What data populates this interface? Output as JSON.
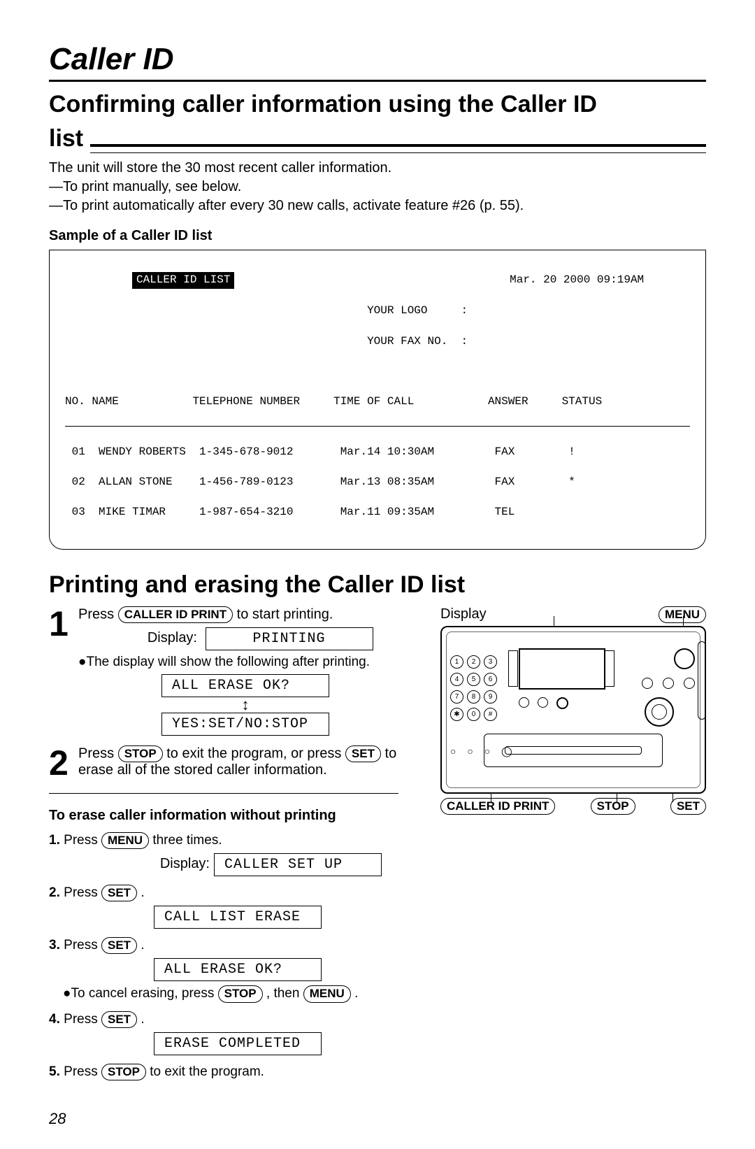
{
  "page_title": "Caller ID",
  "section1": {
    "title_line1": "Confirming caller information using the Caller ID",
    "title_line2": "list",
    "intro": "The unit will store the 30 most recent caller information.",
    "line_a": "—To print manually, see below.",
    "line_b": "—To print automatically after every 30 new calls, activate feature #26 (p. 55).",
    "sample_head": "Sample of a Caller ID list",
    "list_badge": "CALLER ID LIST",
    "list_date": "Mar. 20 2000 09:19AM",
    "logo_line": "YOUR LOGO     :",
    "fax_line": "YOUR FAX NO.  :",
    "columns": {
      "no": "NO.",
      "name": "NAME",
      "tel": "TELEPHONE NUMBER",
      "time": "TIME OF CALL",
      "answer": "ANSWER",
      "status": "STATUS"
    },
    "rows": [
      {
        "no": "01",
        "name": "WENDY ROBERTS",
        "tel": "1-345-678-9012",
        "time": "Mar.14 10:30AM",
        "answer": "FAX",
        "status": "!"
      },
      {
        "no": "02",
        "name": "ALLAN STONE",
        "tel": "1-456-789-0123",
        "time": "Mar.13 08:35AM",
        "answer": "FAX",
        "status": "*"
      },
      {
        "no": "03",
        "name": "MIKE TIMAR",
        "tel": "1-987-654-3210",
        "time": "Mar.11 09:35AM",
        "answer": "TEL",
        "status": ""
      }
    ]
  },
  "section2": {
    "title": "Printing and erasing the Caller ID list",
    "step1_a": "Press ",
    "step1_btn": "CALLER ID PRINT",
    "step1_c": " to start printing.",
    "disp_label": "Display:",
    "lcd1": "PRINTING",
    "step1_note": "●The display will show the following after printing.",
    "lcd2": "ALL ERASE OK?",
    "lcd3": "YES:SET/NO:STOP",
    "step2_a": "Press ",
    "step2_btn1": "STOP",
    "step2_b": " to exit the program, or press ",
    "step2_btn2": "SET",
    "step2_c": " to erase all of the stored caller information."
  },
  "erase": {
    "head": "To erase caller information without printing",
    "s1_a": "Press ",
    "s1_btn": "MENU",
    "s1_b": " three times.",
    "lcd_e1": "CALLER SET UP",
    "s2_a": "Press ",
    "s2_btn": "SET",
    "s2_b": " .",
    "lcd_e2": "CALL LIST ERASE",
    "s3_a": "Press ",
    "s3_btn": "SET",
    "s3_b": " .",
    "lcd_e3": "ALL ERASE OK?",
    "s3_note_a": "●To cancel erasing, press ",
    "s3_note_btn1": "STOP",
    "s3_note_b": " , then ",
    "s3_note_btn2": "MENU",
    "s3_note_c": " .",
    "s4_a": "Press ",
    "s4_btn": "SET",
    "s4_b": " .",
    "lcd_e4": "ERASE COMPLETED",
    "s5_a": "Press ",
    "s5_btn": "STOP",
    "s5_b": " to exit the program."
  },
  "diagram": {
    "label_display": "Display",
    "label_menu": "MENU",
    "label_cidprint": "CALLER ID PRINT",
    "label_stop": "STOP",
    "label_set": "SET",
    "keys": [
      "1",
      "2",
      "3",
      "4",
      "5",
      "6",
      "7",
      "8",
      "9",
      "✱",
      "0",
      "#"
    ]
  },
  "page_number": "28"
}
